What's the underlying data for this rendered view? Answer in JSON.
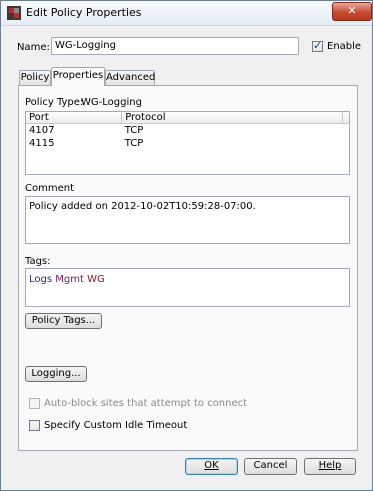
{
  "window": {
    "title": "Edit Policy Properties",
    "close_symbol": "✕"
  },
  "name_row": {
    "label": "Name:",
    "value": "WG-Logging",
    "enable_label": "Enable",
    "enable_checked": true
  },
  "tabs": [
    {
      "label": "Policy",
      "active": false
    },
    {
      "label": "Properties",
      "active": true
    },
    {
      "label": "Advanced",
      "active": false
    }
  ],
  "properties": {
    "policy_type_label": "Policy Type:",
    "policy_type_value": "WG-Logging",
    "ports_table": {
      "columns": [
        "Port",
        "Protocol"
      ],
      "rows": [
        [
          "4107",
          "TCP"
        ],
        [
          "4115",
          "TCP"
        ]
      ]
    },
    "comment_label": "Comment",
    "comment_value": "Policy added on 2012-10-02T10:59:28-07:00.",
    "tags_label": "Tags:",
    "tags": [
      {
        "text": "Logs",
        "color": "#2a2a8a"
      },
      {
        "text": "Mgmt",
        "color": "#6a1a6a"
      },
      {
        "text": "WG",
        "color": "#a01818"
      }
    ],
    "policy_tags_button": "Policy Tags...",
    "logging_button": "Logging...",
    "auto_block_label": "Auto-block sites that attempt to connect",
    "auto_block_checked": false,
    "auto_block_enabled": false,
    "idle_timeout_label": "Specify Custom Idle Timeout",
    "idle_timeout_checked": false
  },
  "footer": {
    "ok_label": "OK",
    "cancel_label": "Cancel",
    "help_label": "Help"
  },
  "colors": {
    "title_bg": "#e6edf6",
    "close_red": "#c94a32",
    "default_button_border": "#3c7fb1",
    "disabled_text": "#8a8a8a"
  }
}
